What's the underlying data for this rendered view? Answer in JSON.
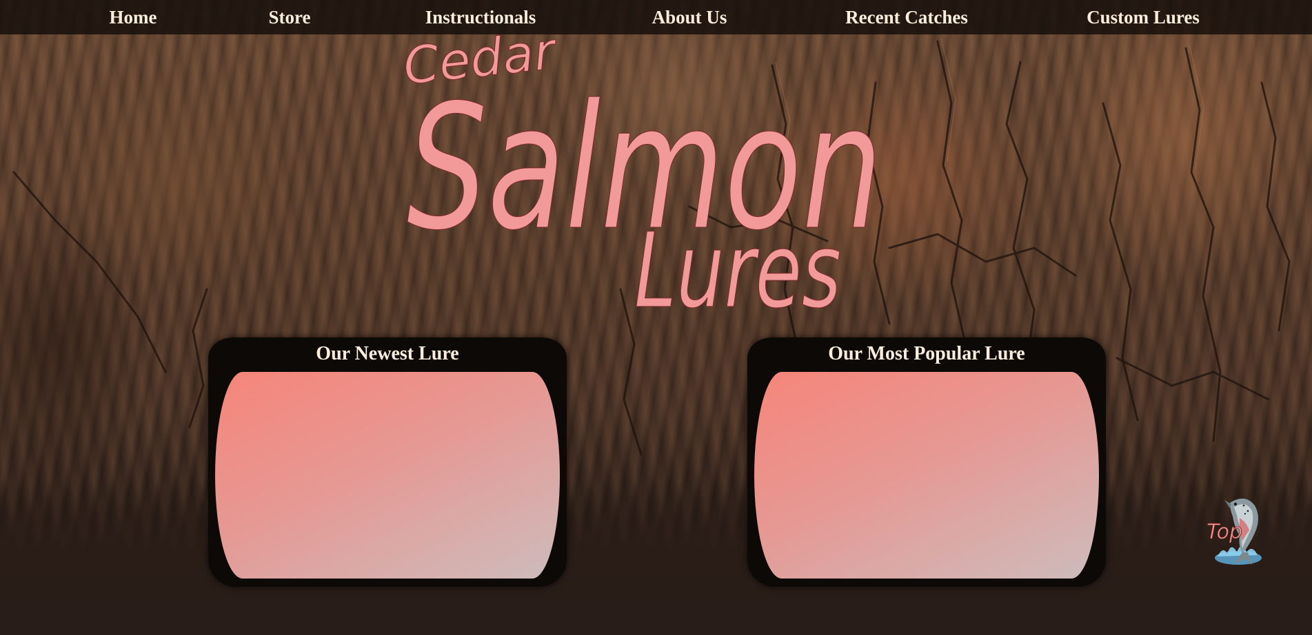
{
  "nav": {
    "items": [
      {
        "label": "Home"
      },
      {
        "label": "Store"
      },
      {
        "label": "Instructionals"
      },
      {
        "label": "About Us"
      },
      {
        "label": "Recent Catches"
      },
      {
        "label": "Custom Lures"
      }
    ]
  },
  "logo": {
    "line1": "Cedar",
    "line2": "Salmon",
    "line3": "Lures"
  },
  "panels": {
    "newest": {
      "title": "Our Newest Lure"
    },
    "popular": {
      "title": "Our Most Popular Lure"
    }
  },
  "top_button": {
    "label": "Top",
    "icon": "jumping-salmon-icon"
  },
  "colors": {
    "logo_pink": "#f29a9a",
    "nav_text": "#fbeedd",
    "panel_bg": "#0d0907",
    "panel_gradient_start": "#f6857a",
    "panel_gradient_end": "#cdbcbc"
  }
}
